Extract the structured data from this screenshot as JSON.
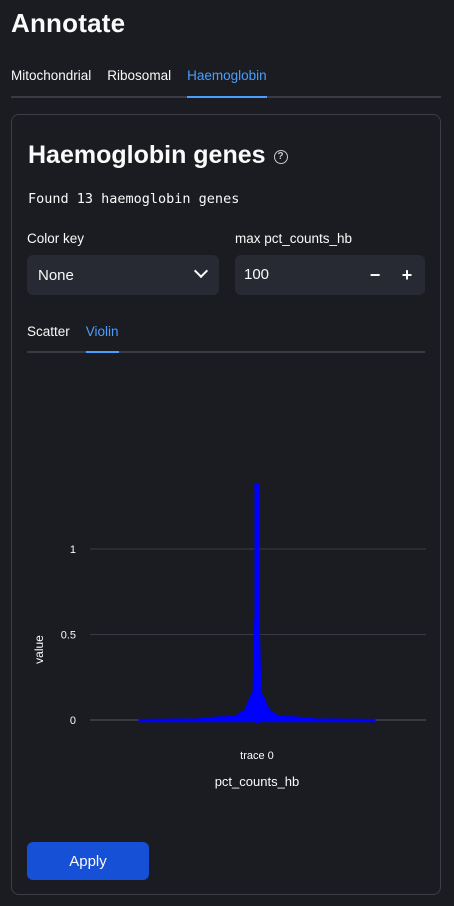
{
  "page": {
    "title": "Annotate"
  },
  "top_tabs": [
    {
      "label": "Mitochondrial",
      "active": false
    },
    {
      "label": "Ribosomal",
      "active": false
    },
    {
      "label": "Haemoglobin",
      "active": true
    }
  ],
  "section": {
    "title": "Haemoglobin genes",
    "help_icon": "question-circle-icon",
    "found_text": "Found 13 haemoglobin genes"
  },
  "color_key": {
    "label": "Color key",
    "value": "None",
    "icon": "chevron-down-icon"
  },
  "max_field": {
    "label": "max pct_counts_hb",
    "value": "100",
    "minus": "−",
    "plus": "+"
  },
  "sub_tabs": [
    {
      "label": "Scatter",
      "active": false
    },
    {
      "label": "Violin",
      "active": true
    }
  ],
  "chart_data": {
    "type": "violin",
    "series": [
      {
        "name": "trace 0",
        "points": [
          0,
          0,
          0.01,
          0.02,
          0.03,
          0.05,
          0.08,
          0.12,
          0.22,
          0.35,
          0.45,
          0.48,
          0.51,
          1.37
        ]
      }
    ],
    "xlabel": "pct_counts_hb",
    "ylabel": "value",
    "y_ticks": [
      "0",
      "0.5",
      "1"
    ],
    "ylim": [
      -0.1,
      1.45
    ],
    "grid": true,
    "color": "#0000ff"
  },
  "apply_button": {
    "label": "Apply"
  },
  "colors": {
    "accent": "#4a9eff",
    "button": "#1650d6",
    "background": "#1b1c21",
    "input": "#282a33"
  }
}
